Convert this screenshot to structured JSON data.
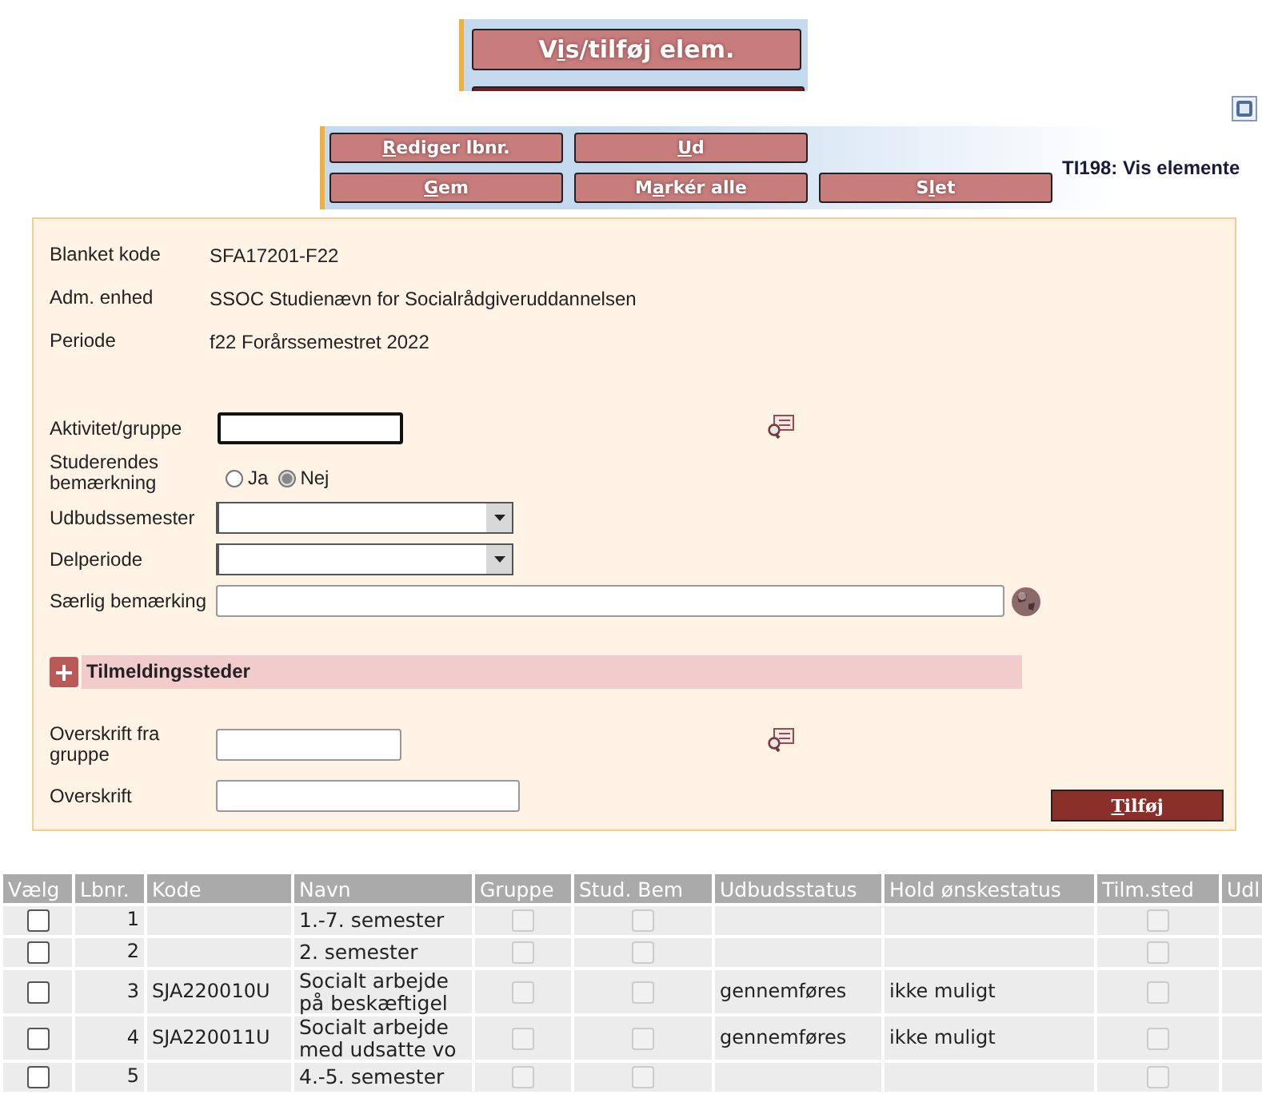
{
  "top_button": {
    "label_parts": [
      "V",
      "i",
      "s/tilføj elem."
    ]
  },
  "toolbar": {
    "title": "TI198: Vis elemente",
    "buttons": [
      {
        "label_parts": [
          "R",
          "ediger lbnr."
        ]
      },
      {
        "label_parts": [
          "U",
          "d"
        ]
      },
      {
        "label_parts": [
          "G",
          "em"
        ]
      },
      {
        "label_parts": [
          "M",
          "a",
          "rkér alle"
        ]
      },
      {
        "label_parts": [
          "S",
          "l",
          "et"
        ]
      }
    ]
  },
  "info": [
    {
      "label": "Blanket kode",
      "value": "SFA17201-F22"
    },
    {
      "label": "Adm. enhed",
      "value": "SSOC Studienævn for Socialrådgiveruddannelsen"
    },
    {
      "label": "Periode",
      "value": "f22  Forårssemestret 2022"
    }
  ],
  "fields": [
    {
      "kind": "text",
      "label": "Aktivitet/gruppe",
      "focused": true,
      "lookup": true
    },
    {
      "kind": "radio",
      "label": "Studerendes bemærkning",
      "options": [
        {
          "label": "Ja",
          "selected": false
        },
        {
          "label": "Nej",
          "selected": true
        }
      ]
    },
    {
      "kind": "select",
      "label": "Udbudssemester"
    },
    {
      "kind": "select",
      "label": "Delperiode"
    },
    {
      "kind": "text",
      "label": "Særlig bemærking",
      "globe": true
    }
  ],
  "section": {
    "title": "Tilmeldingssteder",
    "expanded": false
  },
  "fields2": [
    {
      "kind": "text",
      "label": "Overskrift fra gruppe",
      "lookup": true
    },
    {
      "kind": "text",
      "label": "Overskrift"
    }
  ],
  "add_button": {
    "label_parts": [
      "T",
      "ilføj"
    ]
  },
  "table": {
    "columns": [
      {
        "label": "Vælg",
        "kind": "checkbox",
        "disabled": false
      },
      {
        "label": "Lbnr.",
        "kind": "number"
      },
      {
        "label": "Kode",
        "kind": "text"
      },
      {
        "label": "Navn",
        "kind": "text"
      },
      {
        "label": "Gruppe",
        "kind": "checkbox",
        "disabled": true
      },
      {
        "label": "Stud. Bem",
        "kind": "checkbox",
        "disabled": true
      },
      {
        "label": "Udbudsstatus",
        "kind": "text"
      },
      {
        "label": "Hold ønskestatus",
        "kind": "text"
      },
      {
        "label": "Tilm.sted",
        "kind": "checkbox",
        "disabled": true
      },
      {
        "label": "Udl",
        "kind": "text"
      }
    ],
    "rows": [
      {
        "cells": [
          {
            "checked": false
          },
          "1",
          "",
          "1.-7. semester",
          {
            "checked": false
          },
          {
            "checked": false
          },
          "",
          "",
          {
            "checked": false
          },
          ""
        ]
      },
      {
        "cells": [
          {
            "checked": false
          },
          "2",
          "",
          "2. semester",
          {
            "checked": false
          },
          {
            "checked": false
          },
          "",
          "",
          {
            "checked": false
          },
          ""
        ]
      },
      {
        "cells": [
          {
            "checked": false
          },
          "3",
          "SJA220010U",
          "Socialt arbejde på beskæftigel",
          {
            "checked": false
          },
          {
            "checked": false
          },
          "gennemføres",
          "ikke muligt",
          {
            "checked": false
          },
          ""
        ]
      },
      {
        "cells": [
          {
            "checked": false
          },
          "4",
          "SJA220011U",
          "Socialt arbejde med udsatte vo",
          {
            "checked": false
          },
          {
            "checked": false
          },
          "gennemføres",
          "ikke muligt",
          {
            "checked": false
          },
          ""
        ]
      },
      {
        "cells": [
          {
            "checked": false
          },
          "5",
          "",
          "4.-5. semester",
          {
            "checked": false
          },
          {
            "checked": false
          },
          "",
          "",
          {
            "checked": false
          },
          ""
        ]
      }
    ]
  }
}
